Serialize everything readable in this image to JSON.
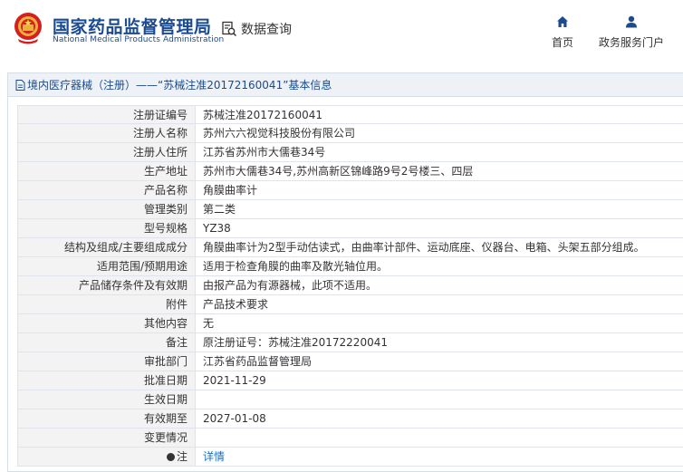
{
  "header": {
    "brand_cn": "国家药品监督管理局",
    "brand_en": "National Medical Products Administration",
    "query_label": "数据查询",
    "nav": [
      {
        "label": "首页",
        "icon": "home-icon"
      },
      {
        "label": "政务服务门户",
        "icon": "user-icon"
      }
    ]
  },
  "panel": {
    "title": "境内医疗器械（注册）——“苏械注准20172160041”基本信息",
    "rows": [
      {
        "label": "注册证编号",
        "value": "苏械注准20172160041"
      },
      {
        "label": "注册人名称",
        "value": "苏州六六视觉科技股份有限公司"
      },
      {
        "label": "注册人住所",
        "value": "江苏省苏州市大儒巷34号"
      },
      {
        "label": "生产地址",
        "value": "苏州市大儒巷34号,苏州高新区锦峰路9号2号楼三、四层"
      },
      {
        "label": "产品名称",
        "value": "角膜曲率计"
      },
      {
        "label": "管理类别",
        "value": "第二类"
      },
      {
        "label": "型号规格",
        "value": "YZ38"
      },
      {
        "label": "结构及组成/主要组成成分",
        "value": "角膜曲率计为2型手动估读式，由曲率计部件、运动底座、仪器台、电箱、头架五部分组成。"
      },
      {
        "label": "适用范围/预期用途",
        "value": "适用于检查角膜的曲率及散光轴位用。"
      },
      {
        "label": "产品储存条件及有效期",
        "value": "由报产品为有源器械，此项不适用。"
      },
      {
        "label": "附件",
        "value": "产品技术要求"
      },
      {
        "label": "其他内容",
        "value": "无"
      },
      {
        "label": "备注",
        "value": "原注册证号：苏械注准20172220041"
      },
      {
        "label": "审批部门",
        "value": "江苏省药品监督管理局"
      },
      {
        "label": "批准日期",
        "value": "2021-11-29"
      },
      {
        "label": "生效日期",
        "value": ""
      },
      {
        "label": "有效期至",
        "value": "2027-01-08"
      },
      {
        "label": "变更情况",
        "value": ""
      },
      {
        "label": "注",
        "value": "详情",
        "is_link": true
      }
    ]
  },
  "colors": {
    "brand": "#1a4a8f",
    "link": "#1a6fc4",
    "label_bg": "#f3f3f3",
    "header_bg": "#eef2f7"
  }
}
